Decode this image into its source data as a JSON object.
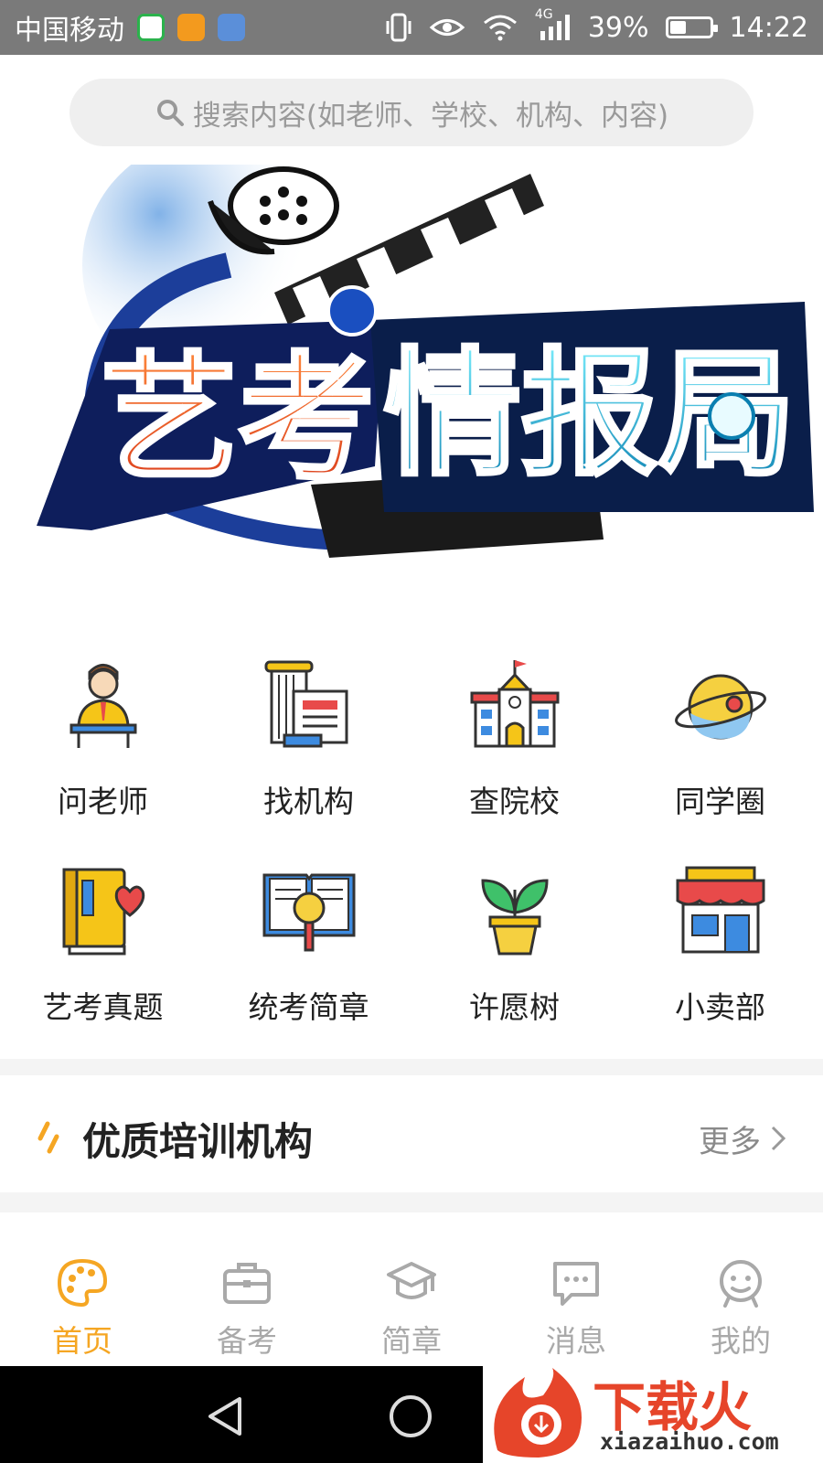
{
  "status_bar": {
    "carrier": "中国移动",
    "network": "4G",
    "battery": "39%",
    "battery_level": 0.39,
    "time": "14:22",
    "icons": [
      "app-icon-green",
      "app-icon-orange",
      "app-icon-blue",
      "vibrate-icon",
      "eye-icon",
      "wifi-icon",
      "signal-icon",
      "battery-icon"
    ]
  },
  "search": {
    "placeholder": "搜索内容(如老师、学校、机构、内容)",
    "icon": "search-icon"
  },
  "banner": {
    "logo_text": "艺考情报局"
  },
  "grid": {
    "items": [
      {
        "label": "问老师",
        "icon": "teacher-icon"
      },
      {
        "label": "找机构",
        "icon": "institution-icon"
      },
      {
        "label": "查院校",
        "icon": "school-icon"
      },
      {
        "label": "同学圈",
        "icon": "planet-icon"
      },
      {
        "label": "艺考真题",
        "icon": "book-heart-icon"
      },
      {
        "label": "统考简章",
        "icon": "book-magnifier-icon"
      },
      {
        "label": "许愿树",
        "icon": "plant-icon"
      },
      {
        "label": "小卖部",
        "icon": "shop-icon"
      }
    ]
  },
  "section": {
    "title": "优质培训机构",
    "more": "更多"
  },
  "tabbar": {
    "items": [
      {
        "label": "首页",
        "icon": "palette-icon",
        "active": true
      },
      {
        "label": "备考",
        "icon": "briefcase-icon",
        "active": false
      },
      {
        "label": "简章",
        "icon": "graduation-cap-icon",
        "active": false
      },
      {
        "label": "消息",
        "icon": "message-icon",
        "active": false
      },
      {
        "label": "我的",
        "icon": "face-icon",
        "active": false
      }
    ]
  },
  "watermark": {
    "text": "下载火",
    "url": "xiazaihuo.com"
  },
  "colors": {
    "accent": "#f5a623",
    "status_bar": "#7a7a7a",
    "inactive": "#a9a9a9"
  }
}
